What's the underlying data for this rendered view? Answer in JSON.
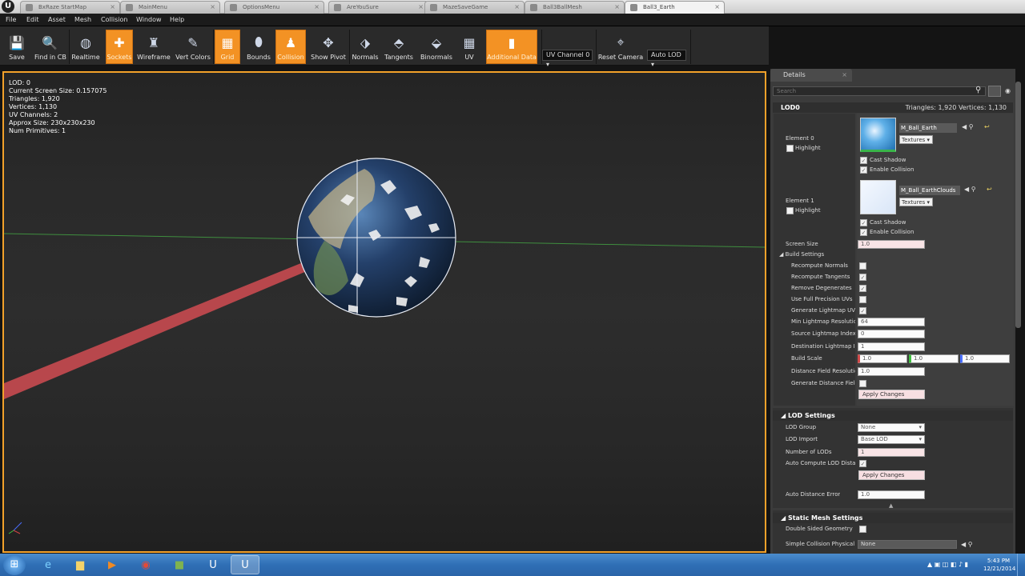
{
  "browser_tabs": [
    {
      "label": "BxRaze StartMap",
      "active": false
    },
    {
      "label": "MainMenu",
      "active": false
    },
    {
      "label": "OptionsMenu",
      "active": false
    },
    {
      "label": "AreYouSure",
      "active": false
    },
    {
      "label": "MazeSaveGame",
      "active": false
    },
    {
      "label": "Ball3BallMesh",
      "active": false
    },
    {
      "label": "Ball3_Earth",
      "active": true
    }
  ],
  "menus": [
    "File",
    "Edit",
    "Asset",
    "Mesh",
    "Collision",
    "Window",
    "Help"
  ],
  "toolbar": {
    "buttons": [
      {
        "label": "Save",
        "icon": "save-icon",
        "on": false
      },
      {
        "label": "Find in CB",
        "icon": "find-icon",
        "on": false
      },
      {
        "label": "Realtime",
        "icon": "realtime-icon",
        "on": false
      },
      {
        "label": "Sockets",
        "icon": "sockets-icon",
        "on": true
      },
      {
        "label": "Wireframe",
        "icon": "wireframe-icon",
        "on": false
      },
      {
        "label": "Vert Colors",
        "icon": "vert-colors-icon",
        "on": false
      },
      {
        "label": "Grid",
        "icon": "grid-icon",
        "on": true
      },
      {
        "label": "Bounds",
        "icon": "bounds-icon",
        "on": false
      },
      {
        "label": "Collision",
        "icon": "collision-icon",
        "on": true
      },
      {
        "label": "Show Pivot",
        "icon": "pivot-icon",
        "on": false
      },
      {
        "label": "Normals",
        "icon": "normals-icon",
        "on": false
      },
      {
        "label": "Tangents",
        "icon": "tangents-icon",
        "on": false
      },
      {
        "label": "Binormals",
        "icon": "binormals-icon",
        "on": false
      },
      {
        "label": "UV",
        "icon": "uv-icon",
        "on": false
      },
      {
        "label": "Additional Data",
        "icon": "additional-data-icon",
        "on": true
      },
      {
        "label": "Reset Camera",
        "icon": "reset-camera-icon",
        "on": false
      }
    ],
    "uv_channel": "UV Channel 0",
    "auto_lod": "Auto LOD"
  },
  "viewport_stats": [
    "LOD: 0",
    "Current Screen Size: 0.157075",
    "Triangles: 1,920",
    "Vertices: 1,130",
    "UV Channels: 2",
    "Approx Size: 230x230x230",
    "Num Primitives: 1"
  ],
  "details": {
    "tab_label": "Details",
    "search_placeholder": "Search",
    "lod0": {
      "title": "LOD0",
      "summary": "Triangles: 1,920  Vertices: 1,130",
      "elements": [
        {
          "name": "Element 0",
          "highlight": "Highlight",
          "material": "M_Ball_Earth",
          "textures": "Textures",
          "cast_shadow": "Cast Shadow",
          "enable_collision": "Enable Collision"
        },
        {
          "name": "Element 1",
          "highlight": "Highlight",
          "material": "M_Ball_EarthClouds",
          "textures": "Textures",
          "cast_shadow": "Cast Shadow",
          "enable_collision": "Enable Collision"
        }
      ],
      "screen_size_label": "Screen Size",
      "screen_size": "1.0",
      "build_settings_label": "Build Settings",
      "build_rows": [
        {
          "label": "Recompute Normals",
          "type": "check",
          "value": ""
        },
        {
          "label": "Recompute Tangents",
          "type": "check",
          "value": "✓"
        },
        {
          "label": "Remove Degenerates",
          "type": "check",
          "value": "✓"
        },
        {
          "label": "Use Full Precision UVs",
          "type": "check",
          "value": ""
        },
        {
          "label": "Generate Lightmap UVs",
          "type": "check",
          "value": "✓"
        },
        {
          "label": "Min Lightmap Resolution",
          "type": "input",
          "value": "64"
        },
        {
          "label": "Source Lightmap Index",
          "type": "input",
          "value": "0"
        },
        {
          "label": "Destination Lightmap Index",
          "type": "input",
          "value": "1"
        },
        {
          "label": "Build Scale",
          "type": "triple",
          "value": "1.0",
          "value2": "1.0",
          "value3": "1.0"
        },
        {
          "label": "Distance Field Resolution",
          "type": "input",
          "value": "1.0"
        },
        {
          "label": "Generate Distance Field",
          "type": "check",
          "value": ""
        }
      ],
      "apply": "Apply Changes"
    },
    "lod_settings": {
      "title": "LOD Settings",
      "rows": [
        {
          "label": "LOD Group",
          "type": "select",
          "value": "None"
        },
        {
          "label": "LOD Import",
          "type": "select",
          "value": "Base LOD"
        },
        {
          "label": "Number of LODs",
          "type": "input",
          "value": "1"
        },
        {
          "label": "Auto Compute LOD Distances",
          "type": "check",
          "value": "✓"
        }
      ],
      "apply": "Apply Changes",
      "auto_distance_label": "Auto Distance Error",
      "auto_distance": "1.0"
    },
    "static_mesh": {
      "title": "Static Mesh Settings",
      "double_sided_label": "Double Sided Geometry",
      "simple_collision_label": "Simple Collision Physical Material",
      "simple_collision": "None"
    }
  },
  "taskbar": {
    "time": "5:43 PM",
    "date": "12/21/2014",
    "apps": [
      "ie",
      "explorer",
      "media",
      "chrome",
      "minecraft",
      "unreal",
      "unreal-editor"
    ]
  },
  "colors": {
    "accent_orange": "#f39224",
    "viewport_border": "#f2a12a"
  }
}
